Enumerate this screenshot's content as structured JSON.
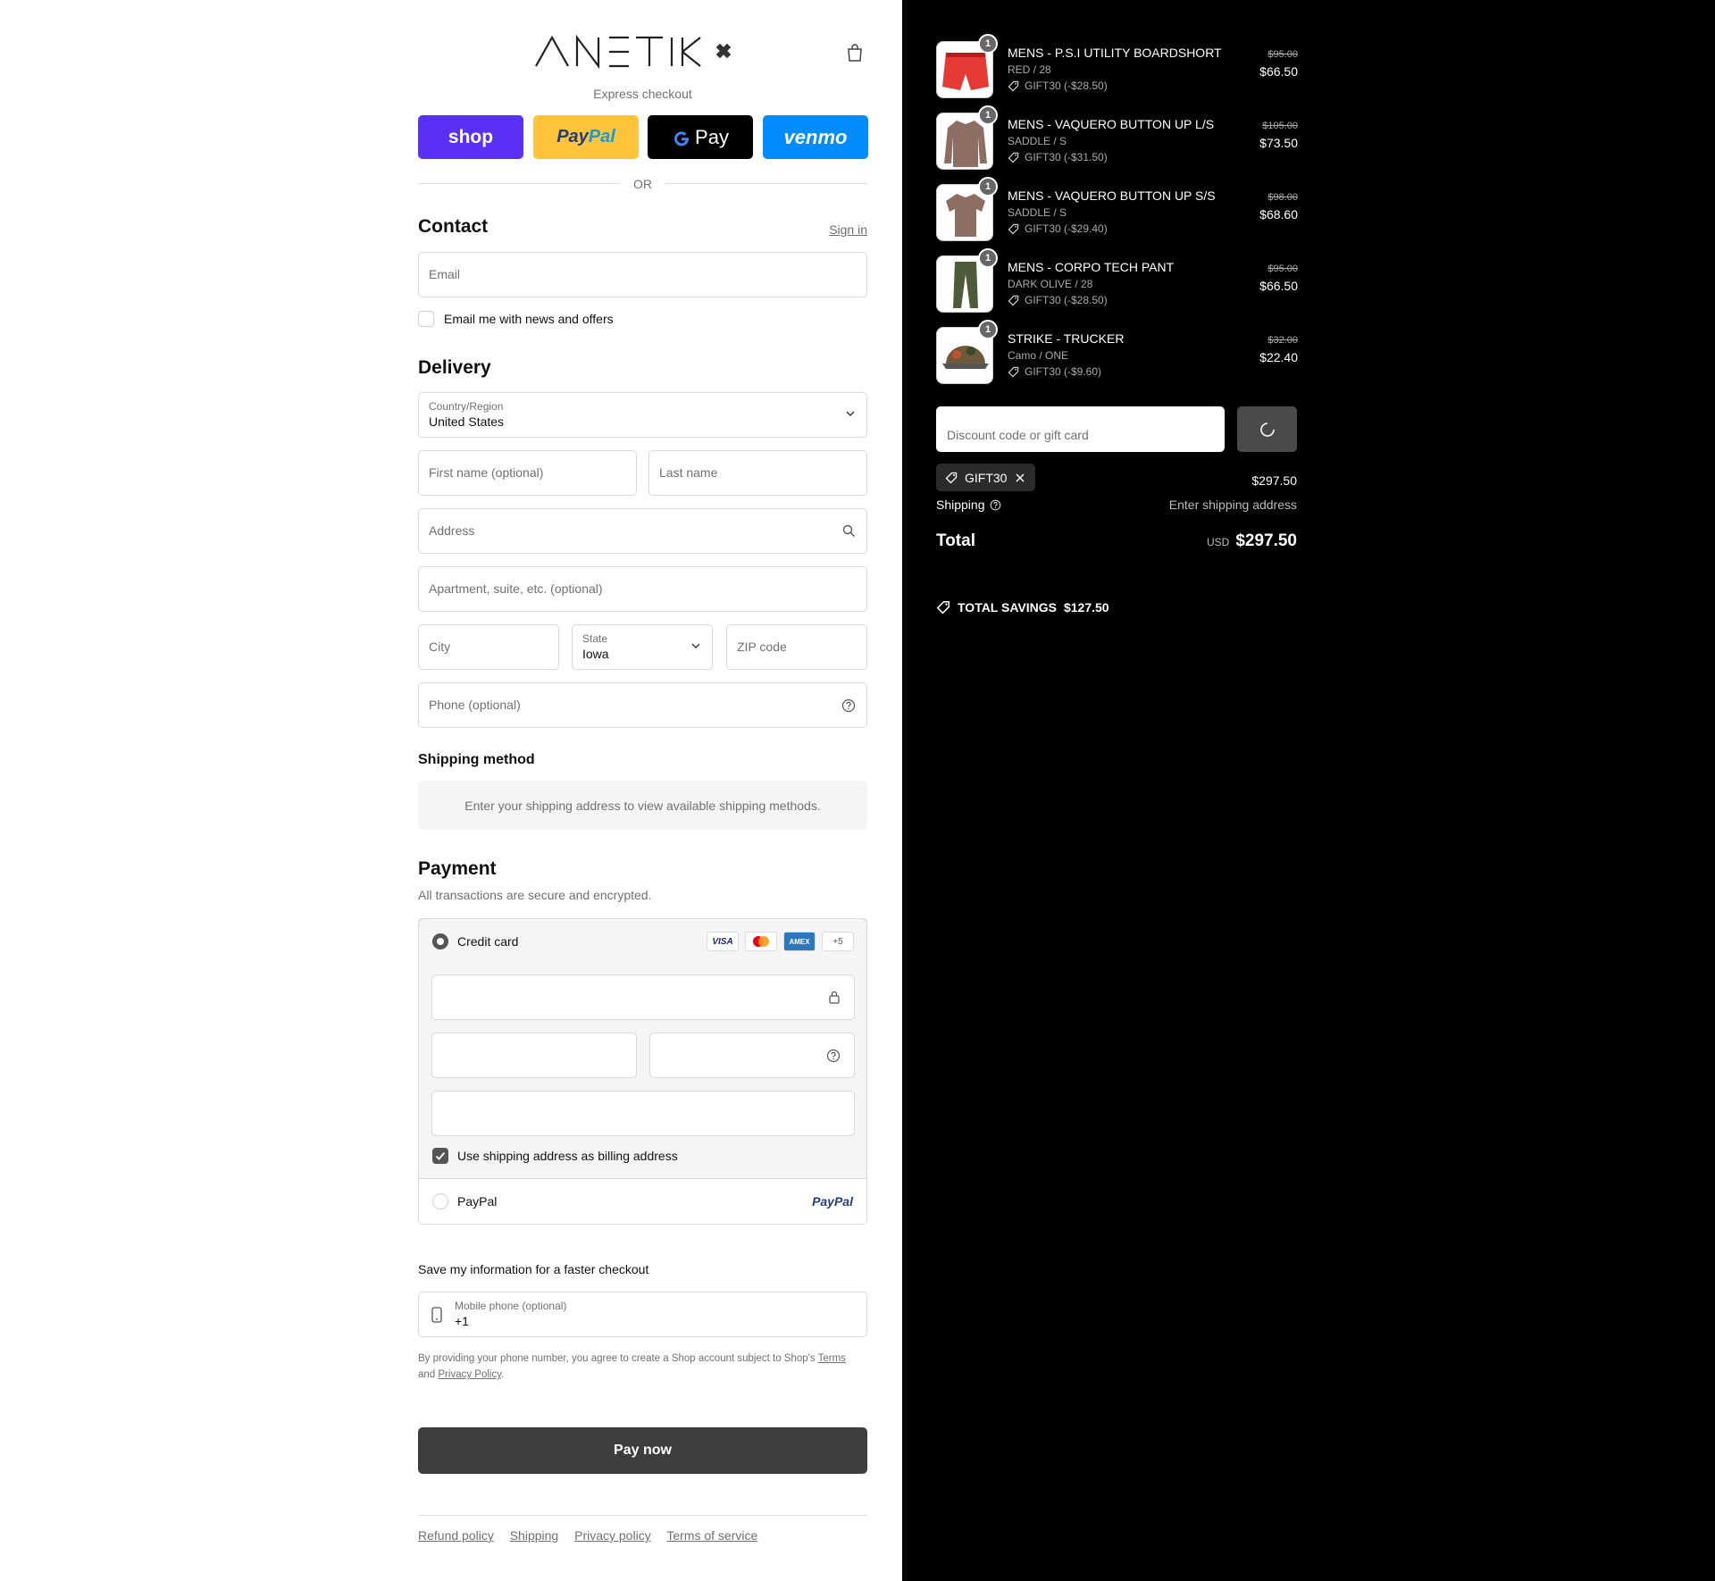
{
  "brand": {
    "name": "ANETIK"
  },
  "express": {
    "label": "Express checkout",
    "buttons": [
      {
        "label": "shop",
        "color": "#5a31f4"
      },
      {
        "label": "PayPal",
        "color": "#ffc439"
      },
      {
        "label": "Pay",
        "color": "#000000"
      },
      {
        "label": "venmo",
        "color": "#008cff"
      }
    ],
    "or": "OR"
  },
  "contact": {
    "title": "Contact",
    "sign_in": "Sign in",
    "email_placeholder": "Email",
    "newsletter": "Email me with news and offers"
  },
  "delivery": {
    "title": "Delivery",
    "country_label": "Country/Region",
    "country_value": "United States",
    "first_name": "First name (optional)",
    "last_name": "Last name",
    "address": "Address",
    "apartment": "Apartment, suite, etc. (optional)",
    "city": "City",
    "state_label": "State",
    "state_value": "Iowa",
    "zip": "ZIP code",
    "phone": "Phone (optional)"
  },
  "shipping_method": {
    "title": "Shipping method",
    "message": "Enter your shipping address to view available shipping methods."
  },
  "payment": {
    "title": "Payment",
    "subtitle": "All transactions are secure and encrypted.",
    "credit_card": "Credit card",
    "cards": [
      "VISA",
      "MC",
      "AMEX",
      "+5"
    ],
    "billing_same": "Use shipping address as billing address",
    "paypal": "PayPal",
    "paypal_logo": "PayPal"
  },
  "save_info": {
    "title": "Save my information for a faster checkout",
    "mobile_label": "Mobile phone (optional)",
    "mobile_value": "+1",
    "legal_prefix": "By providing your phone number, you agree to create a Shop account subject to Shop's",
    "terms": "Terms",
    "and": "and",
    "privacy": "Privacy Policy",
    "period": "."
  },
  "pay_now": "Pay now",
  "footer_links": [
    "Refund policy",
    "Shipping",
    "Privacy policy",
    "Terms of service"
  ],
  "cart": {
    "items": [
      {
        "name": "MENS - P.S.I UTILITY BOARDSHORT",
        "variant": "RED / 28",
        "discount": "GIFT30 (-$28.50)",
        "old_price": "$95.00",
        "price": "$66.50",
        "qty": "1",
        "thumb": "red-shorts"
      },
      {
        "name": "MENS - VAQUERO BUTTON UP L/S",
        "variant": "SADDLE / S",
        "discount": "GIFT30 (-$31.50)",
        "old_price": "$105.00",
        "price": "$73.50",
        "qty": "1",
        "thumb": "shirt-long"
      },
      {
        "name": "MENS - VAQUERO BUTTON UP S/S",
        "variant": "SADDLE / S",
        "discount": "GIFT30 (-$29.40)",
        "old_price": "$98.00",
        "price": "$68.60",
        "qty": "1",
        "thumb": "shirt-short"
      },
      {
        "name": "MENS - CORPO TECH PANT",
        "variant": "DARK OLIVE / 28",
        "discount": "GIFT30 (-$28.50)",
        "old_price": "$95.00",
        "price": "$66.50",
        "qty": "1",
        "thumb": "pants"
      },
      {
        "name": "STRIKE - TRUCKER",
        "variant": "Camo / ONE",
        "discount": "GIFT30 (-$9.60)",
        "old_price": "$32.00",
        "price": "$22.40",
        "qty": "1",
        "thumb": "cap"
      }
    ],
    "discount_placeholder": "Discount code or gift card",
    "applied_code": "GIFT30",
    "subtotal": "$297.50",
    "shipping_label": "Shipping",
    "shipping_value": "Enter shipping address",
    "total_label": "Total",
    "currency": "USD",
    "total": "$297.50",
    "savings_label": "TOTAL SAVINGS",
    "savings_value": "$127.50"
  }
}
